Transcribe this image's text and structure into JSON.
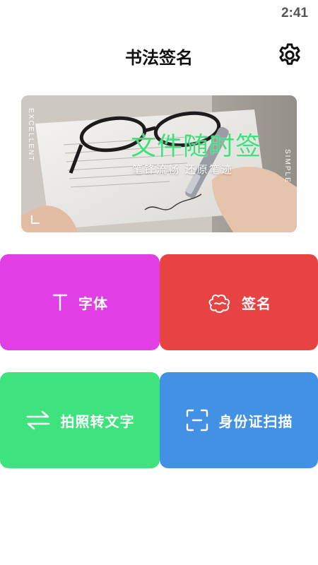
{
  "status_bar": {
    "time": "2:41"
  },
  "header": {
    "title": "书法签名",
    "settings_icon": "gear-icon"
  },
  "banner": {
    "title": "文件随时签",
    "subtitle": "笔锋流畅 还原笔迹",
    "side_left": "EXCELLENT",
    "side_right": "SIMPLE",
    "accent_color": "#3fe07e"
  },
  "tiles": [
    {
      "label": "字体",
      "icon": "text-t-icon",
      "color": "#e13ee6"
    },
    {
      "label": "签名",
      "icon": "signature-cloud-icon",
      "color": "#e74343"
    },
    {
      "label": "拍照转文字",
      "icon": "swap-arrows-icon",
      "color": "#3fe37e"
    },
    {
      "label": "身份证扫描",
      "icon": "scan-frame-icon",
      "color": "#4291e4"
    }
  ]
}
